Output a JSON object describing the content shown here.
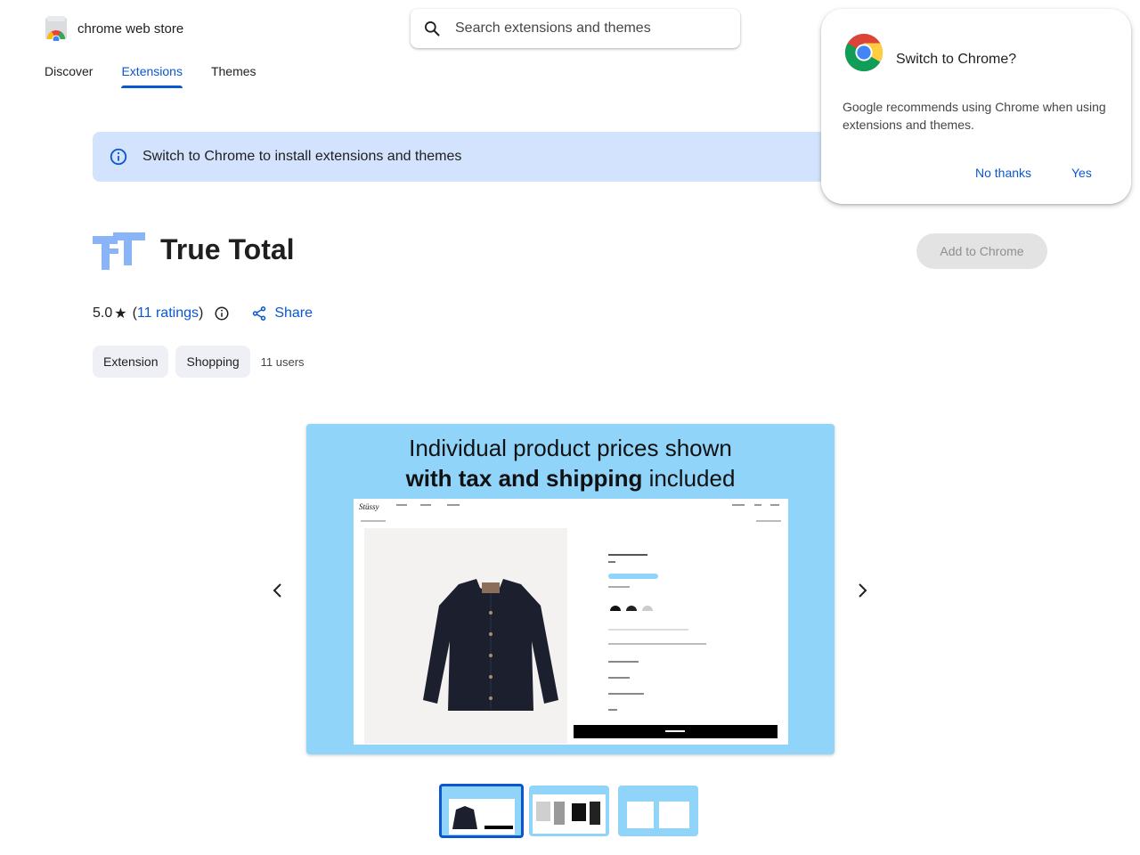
{
  "header": {
    "store_name": "chrome web store",
    "search": {
      "placeholder": "Search extensions and themes",
      "value": ""
    }
  },
  "nav": {
    "items": [
      {
        "label": "Discover",
        "active": false
      },
      {
        "label": "Extensions",
        "active": true
      },
      {
        "label": "Themes",
        "active": false
      }
    ]
  },
  "banner": {
    "text": "Switch to Chrome to install extensions and themes"
  },
  "popup": {
    "title": "Switch to Chrome?",
    "body": "Google recommends using Chrome when using extensions and themes.",
    "no_label": "No thanks",
    "yes_label": "Yes"
  },
  "extension": {
    "title": "True Total",
    "add_label": "Add to Chrome",
    "rating": "5.0",
    "ratings_text": "11 ratings",
    "share_label": "Share",
    "chips": [
      "Extension",
      "Shopping"
    ],
    "users": "11 users"
  },
  "carousel": {
    "line1": "Individual product prices shown",
    "line2_bold": "with tax and shipping",
    "line2_rest": " included",
    "selected_index": 0,
    "thumb_count": 3
  },
  "colors": {
    "accent": "#0b57d0",
    "banner": "#d3e3fd",
    "slide_bg": "#90d4fa",
    "icon_blue": "#8ab4f8"
  }
}
